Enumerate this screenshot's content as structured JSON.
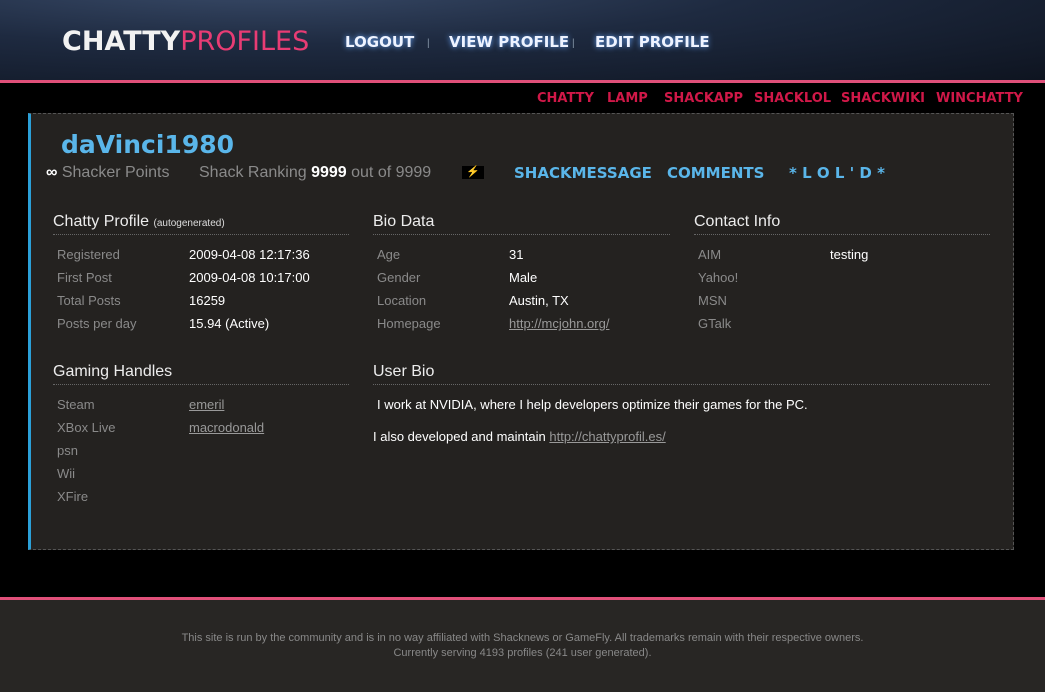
{
  "logo": {
    "part1": "CHATTY",
    "part2": "PROFILES"
  },
  "topnav": {
    "logout": "LOGOUT",
    "view_profile": "VIEW PROFILE",
    "edit_profile": "EDIT PROFILE",
    "separator": "|"
  },
  "subnav": [
    "CHATTY",
    "LAMP",
    "SHACKAPP",
    "SHACKLOL",
    "SHACKWIKI",
    "WINCHATTY"
  ],
  "profile": {
    "username": "daVinci1980",
    "infinity": "∞",
    "shacker_points": "Shacker Points",
    "ranking_label": "Shack Ranking",
    "ranking_value": "9999",
    "ranking_suffix": "out of 9999",
    "bolt_icon": "⚡",
    "links": {
      "shackmessage": "SHACKMESSAGE",
      "comments": "COMMENTS",
      "lold": "* L O L ' D *"
    }
  },
  "chatty_profile": {
    "title": "Chatty Profile",
    "subtitle": "(autogenerated)",
    "rows": [
      {
        "label": "Registered",
        "value": "2009-04-08 12:17:36"
      },
      {
        "label": "First Post",
        "value": "2009-04-08 10:17:00"
      },
      {
        "label": "Total Posts",
        "value": "16259"
      },
      {
        "label": "Posts per day",
        "value": "15.94 (Active)"
      }
    ]
  },
  "bio_data": {
    "title": "Bio Data",
    "rows": [
      {
        "label": "Age",
        "value": "31"
      },
      {
        "label": "Gender",
        "value": "Male"
      },
      {
        "label": "Location",
        "value": "Austin, TX"
      },
      {
        "label": "Homepage",
        "value": "http://mcjohn.org/"
      }
    ]
  },
  "contact_info": {
    "title": "Contact Info",
    "rows": [
      {
        "label": "AIM",
        "value": "testing"
      },
      {
        "label": "Yahoo!",
        "value": ""
      },
      {
        "label": "MSN",
        "value": ""
      },
      {
        "label": "GTalk",
        "value": ""
      }
    ]
  },
  "gaming_handles": {
    "title": "Gaming Handles",
    "rows": [
      {
        "label": "Steam",
        "value": "emeril"
      },
      {
        "label": "XBox Live",
        "value": "macrodonald"
      },
      {
        "label": "psn",
        "value": ""
      },
      {
        "label": "Wii",
        "value": ""
      },
      {
        "label": "XFire",
        "value": ""
      }
    ]
  },
  "user_bio": {
    "title": "User Bio",
    "line1": "I work at NVIDIA, where I help developers optimize their games for the PC.",
    "line2_prefix": "I also developed and maintain",
    "line2_link": "http://chattyprofil.es/"
  },
  "footer": {
    "line1": "This site is run by the community and is in no way affiliated with Shacknews or GameFly. All trademarks remain with their respective owners.",
    "line2": "Currently serving 4193 profiles (241 user generated)."
  }
}
